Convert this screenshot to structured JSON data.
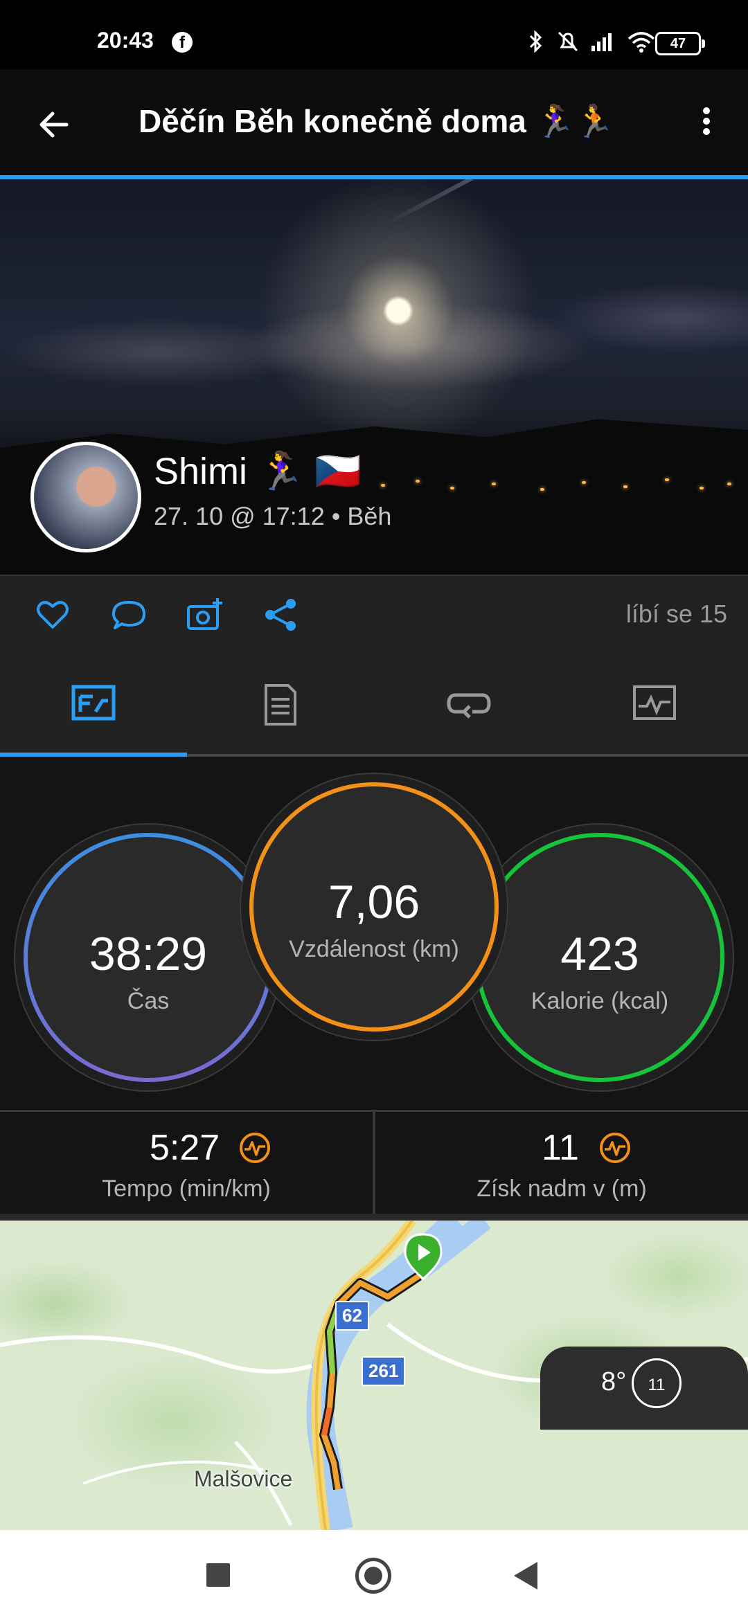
{
  "status_bar": {
    "time": "20:43",
    "battery": "47"
  },
  "header": {
    "title": "Děčín Běh konečně doma 🏃‍♀️🏃"
  },
  "activity": {
    "user_name": "Shimi 🏃‍♀️ 🇨🇿",
    "meta": "27. 10 @ 17:12 • Běh"
  },
  "social": {
    "likes": "líbí se 15"
  },
  "tabs": [
    {
      "icon": "stats-icon",
      "active": true
    },
    {
      "icon": "details-icon",
      "active": false
    },
    {
      "icon": "laps-icon",
      "active": false
    },
    {
      "icon": "chart-icon",
      "active": false
    }
  ],
  "stats": {
    "time": {
      "value": "38:29",
      "label": "Čas",
      "color": "#3b8fe0"
    },
    "distance": {
      "value": "7,06",
      "label": "Vzdálenost (km)",
      "color": "#f29018"
    },
    "calories": {
      "value": "423",
      "label": "Kalorie (kcal)",
      "color": "#16c33a"
    }
  },
  "metrics": {
    "pace": {
      "value": "5:27",
      "label": "Tempo (min/km)"
    },
    "elevation": {
      "value": "11",
      "label": "Získ nadm v (m)"
    }
  },
  "map": {
    "place": "Malšovice",
    "road_badges": [
      "62",
      "261"
    ],
    "weather_temp": "8°",
    "weather_value": "11"
  },
  "colors": {
    "accent": "#2a9df4",
    "pulse": "#f29018"
  }
}
